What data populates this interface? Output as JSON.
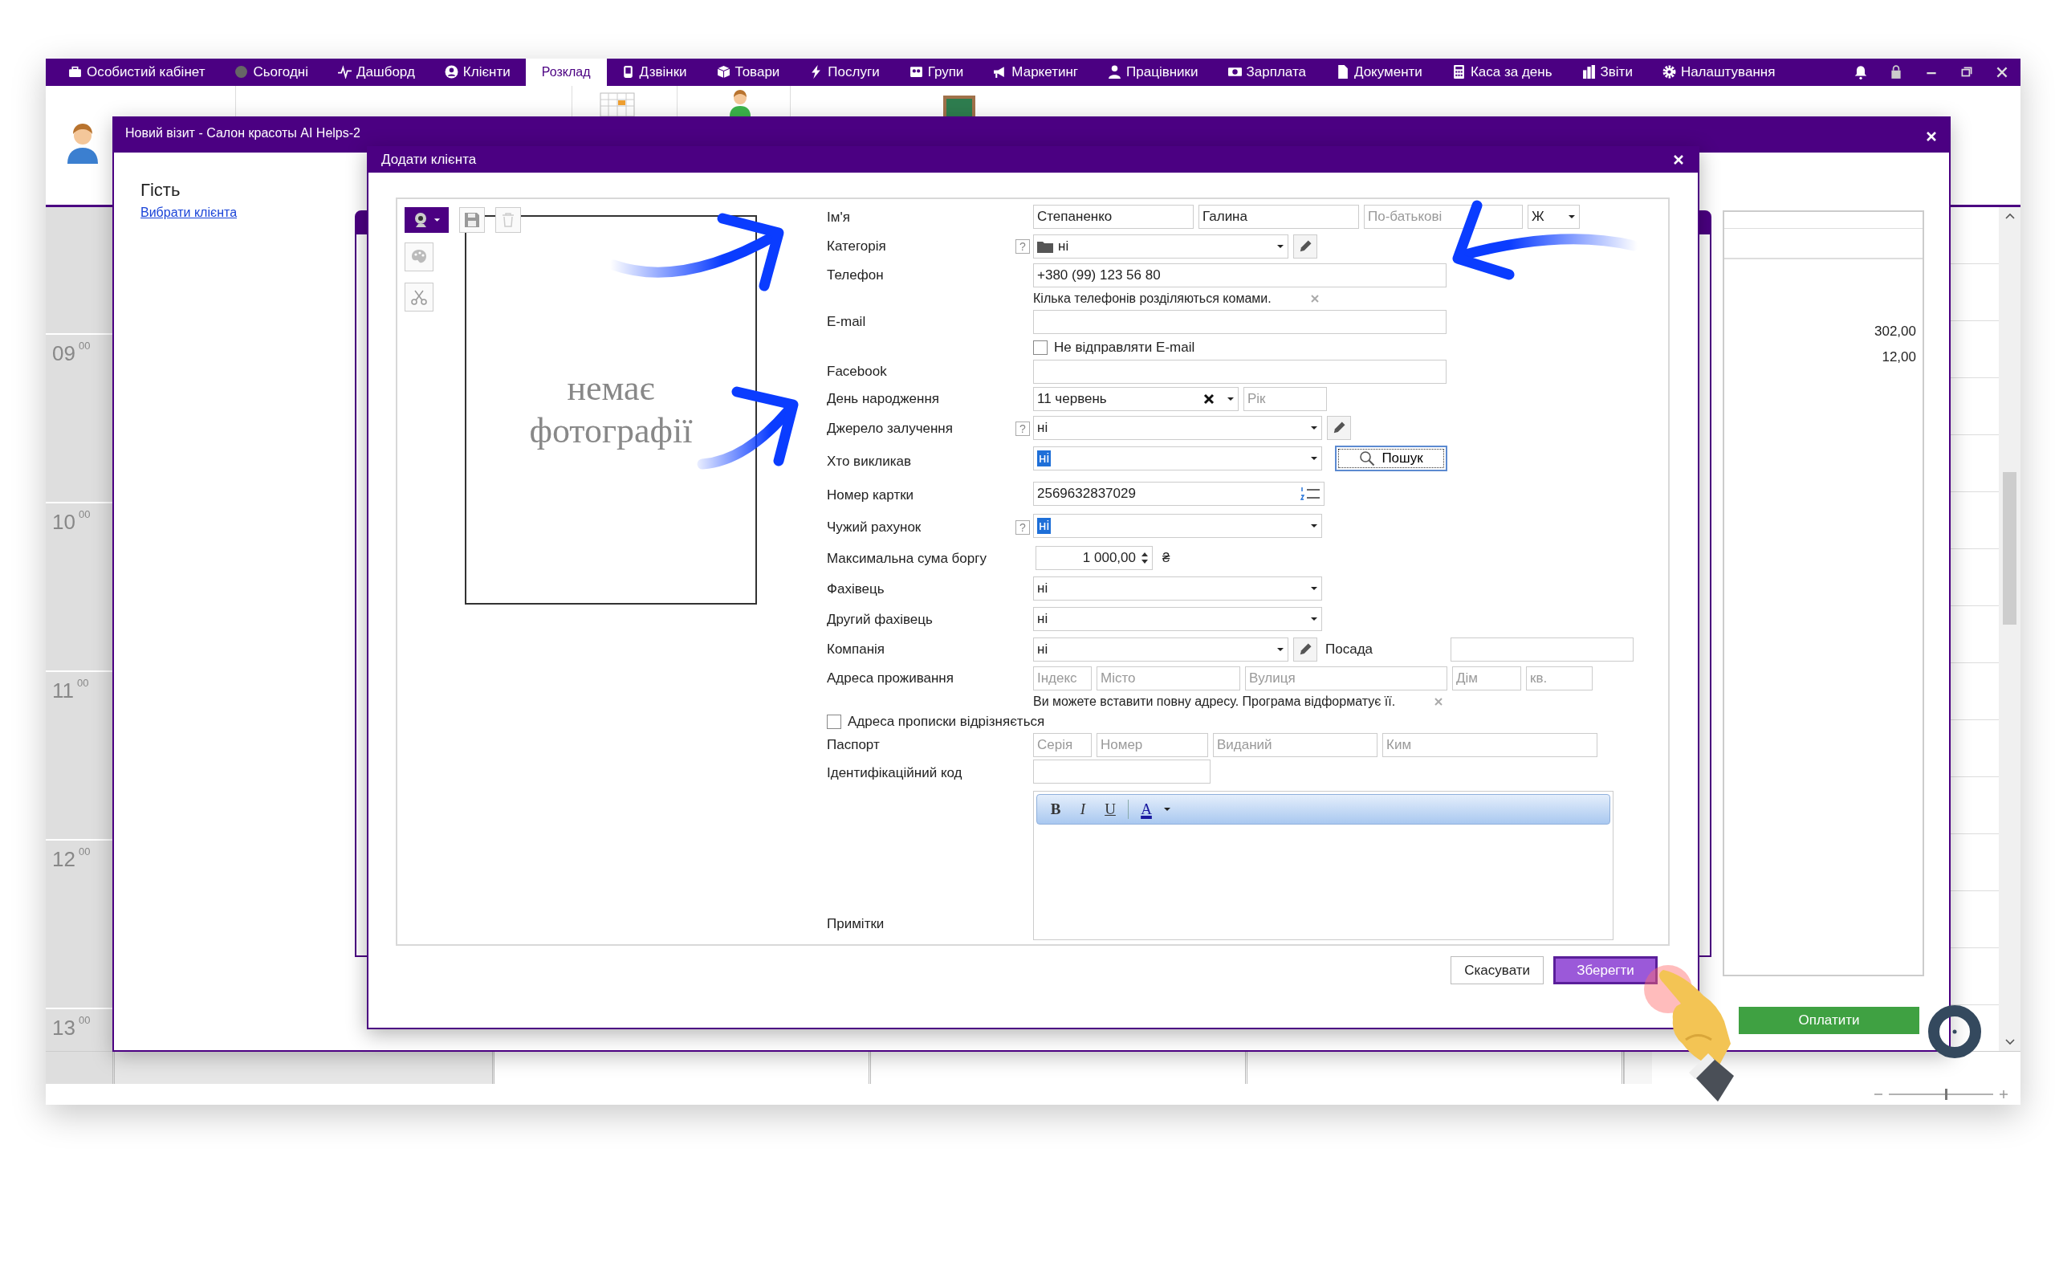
{
  "menu": [
    {
      "label": "Особистий кабінет",
      "selected": false
    },
    {
      "label": "Сьогодні",
      "selected": false
    },
    {
      "label": "Дашборд",
      "selected": false
    },
    {
      "label": "Клієнти",
      "selected": false
    },
    {
      "label": "Розклад",
      "selected": true
    },
    {
      "label": "Дзвінки",
      "selected": false
    },
    {
      "label": "Товари",
      "selected": false
    },
    {
      "label": "Послуги",
      "selected": false
    },
    {
      "label": "Групи",
      "selected": false
    },
    {
      "label": "Маркетинг",
      "selected": false
    },
    {
      "label": "Працівники",
      "selected": false
    },
    {
      "label": "Зарплата",
      "selected": false
    },
    {
      "label": "Документи",
      "selected": false
    },
    {
      "label": "Каса за день",
      "selected": false
    },
    {
      "label": "Звіти",
      "selected": false
    },
    {
      "label": "Налаштування",
      "selected": false
    }
  ],
  "zoom_slider": {
    "level": 0.55
  },
  "schedule": {
    "times": [
      {
        "hour": "09",
        "minutes": "00"
      },
      {
        "hour": "10",
        "minutes": "00"
      },
      {
        "hour": "11",
        "minutes": "00"
      },
      {
        "hour": "12",
        "minutes": "00"
      },
      {
        "hour": "13",
        "minutes": "00"
      }
    ]
  },
  "visit_window": {
    "title": "Новий візит - Салон красоты AI Helps-2",
    "guest_label": "Гість",
    "choose_client_link": "Вибрати клієнта",
    "amounts": [
      "302,00",
      "12,00"
    ],
    "pay_button": "Оплатити"
  },
  "dialog": {
    "title": "Додати клієнта",
    "photo_placeholder": "немає фотографії",
    "rows": [
      {
        "kind": "name",
        "label": "Ім'я",
        "fields": [
          {
            "value": "Степаненко"
          },
          {
            "value": "Галина"
          },
          {
            "placeholder": "По-батькові"
          }
        ],
        "gender": "Ж"
      },
      {
        "kind": "combo",
        "label": "Категорія",
        "help": "?",
        "folder": true,
        "value": "ні",
        "highlighted": false,
        "edit": true
      },
      {
        "kind": "text",
        "label": "Телефон",
        "value": "+380 (99) 123 56 80",
        "hint": "Кілька телефонів розділяються комами."
      },
      {
        "kind": "text",
        "label": "E-mail"
      },
      {
        "kind": "option",
        "label": "Не відправляти E-mail",
        "checked": false
      },
      {
        "kind": "text",
        "label": "Facebook"
      },
      {
        "kind": "date",
        "label": "День народження",
        "value": "11 червень",
        "year_placeholder": "Рік"
      },
      {
        "kind": "combo",
        "label": "Джерело залучення",
        "help": "?",
        "value": "ні",
        "highlighted": false,
        "edit": true
      },
      {
        "kind": "combo",
        "label": "Хто викликав",
        "value": "ні",
        "highlighted": true,
        "search_button": "Пошук"
      },
      {
        "kind": "card",
        "label": "Номер картки",
        "value": "2569632837029"
      },
      {
        "kind": "combo",
        "label": "Чужий рахунок",
        "help": "?",
        "value": "ні",
        "highlighted": true
      },
      {
        "kind": "money",
        "label": "Максимальна сума боргу",
        "value": "1 000,00",
        "currency": "₴"
      },
      {
        "kind": "combo",
        "label": "Фахівець",
        "value": "ні",
        "highlighted": false
      },
      {
        "kind": "combo",
        "label": "Другий фахівець",
        "value": "ні",
        "highlighted": false
      },
      {
        "kind": "combo",
        "label": "Компанія",
        "value": "ні",
        "highlighted": false,
        "edit": true,
        "position_label": "Посада"
      },
      {
        "kind": "parts",
        "label": "Адреса проживання",
        "placeholders": [
          "Індекс",
          "Місто",
          "Вулиця",
          "Дім",
          "кв."
        ],
        "hint": "Ви можете вставити повну адресу. Програма відформатує її."
      },
      {
        "kind": "check",
        "label": "Адреса прописки відрізняється",
        "checked": false
      },
      {
        "kind": "parts",
        "label": "Паспорт",
        "placeholders": [
          "Серія",
          "Номер",
          "Виданий",
          "Ким"
        ]
      },
      {
        "kind": "short",
        "label": "Ідентифікаційний код"
      },
      {
        "kind": "notes",
        "label": "Примітки",
        "tools": [
          {
            "kind": "bold",
            "label": "B"
          },
          {
            "kind": "italic",
            "label": "I"
          },
          {
            "kind": "underline",
            "label": "U"
          },
          {
            "kind": "color",
            "label": "A",
            "color": "#1a1aa0"
          }
        ]
      }
    ],
    "buttons": [
      {
        "label": "Скасувати",
        "primary": false
      },
      {
        "label": "Зберегти",
        "primary": true
      }
    ]
  }
}
